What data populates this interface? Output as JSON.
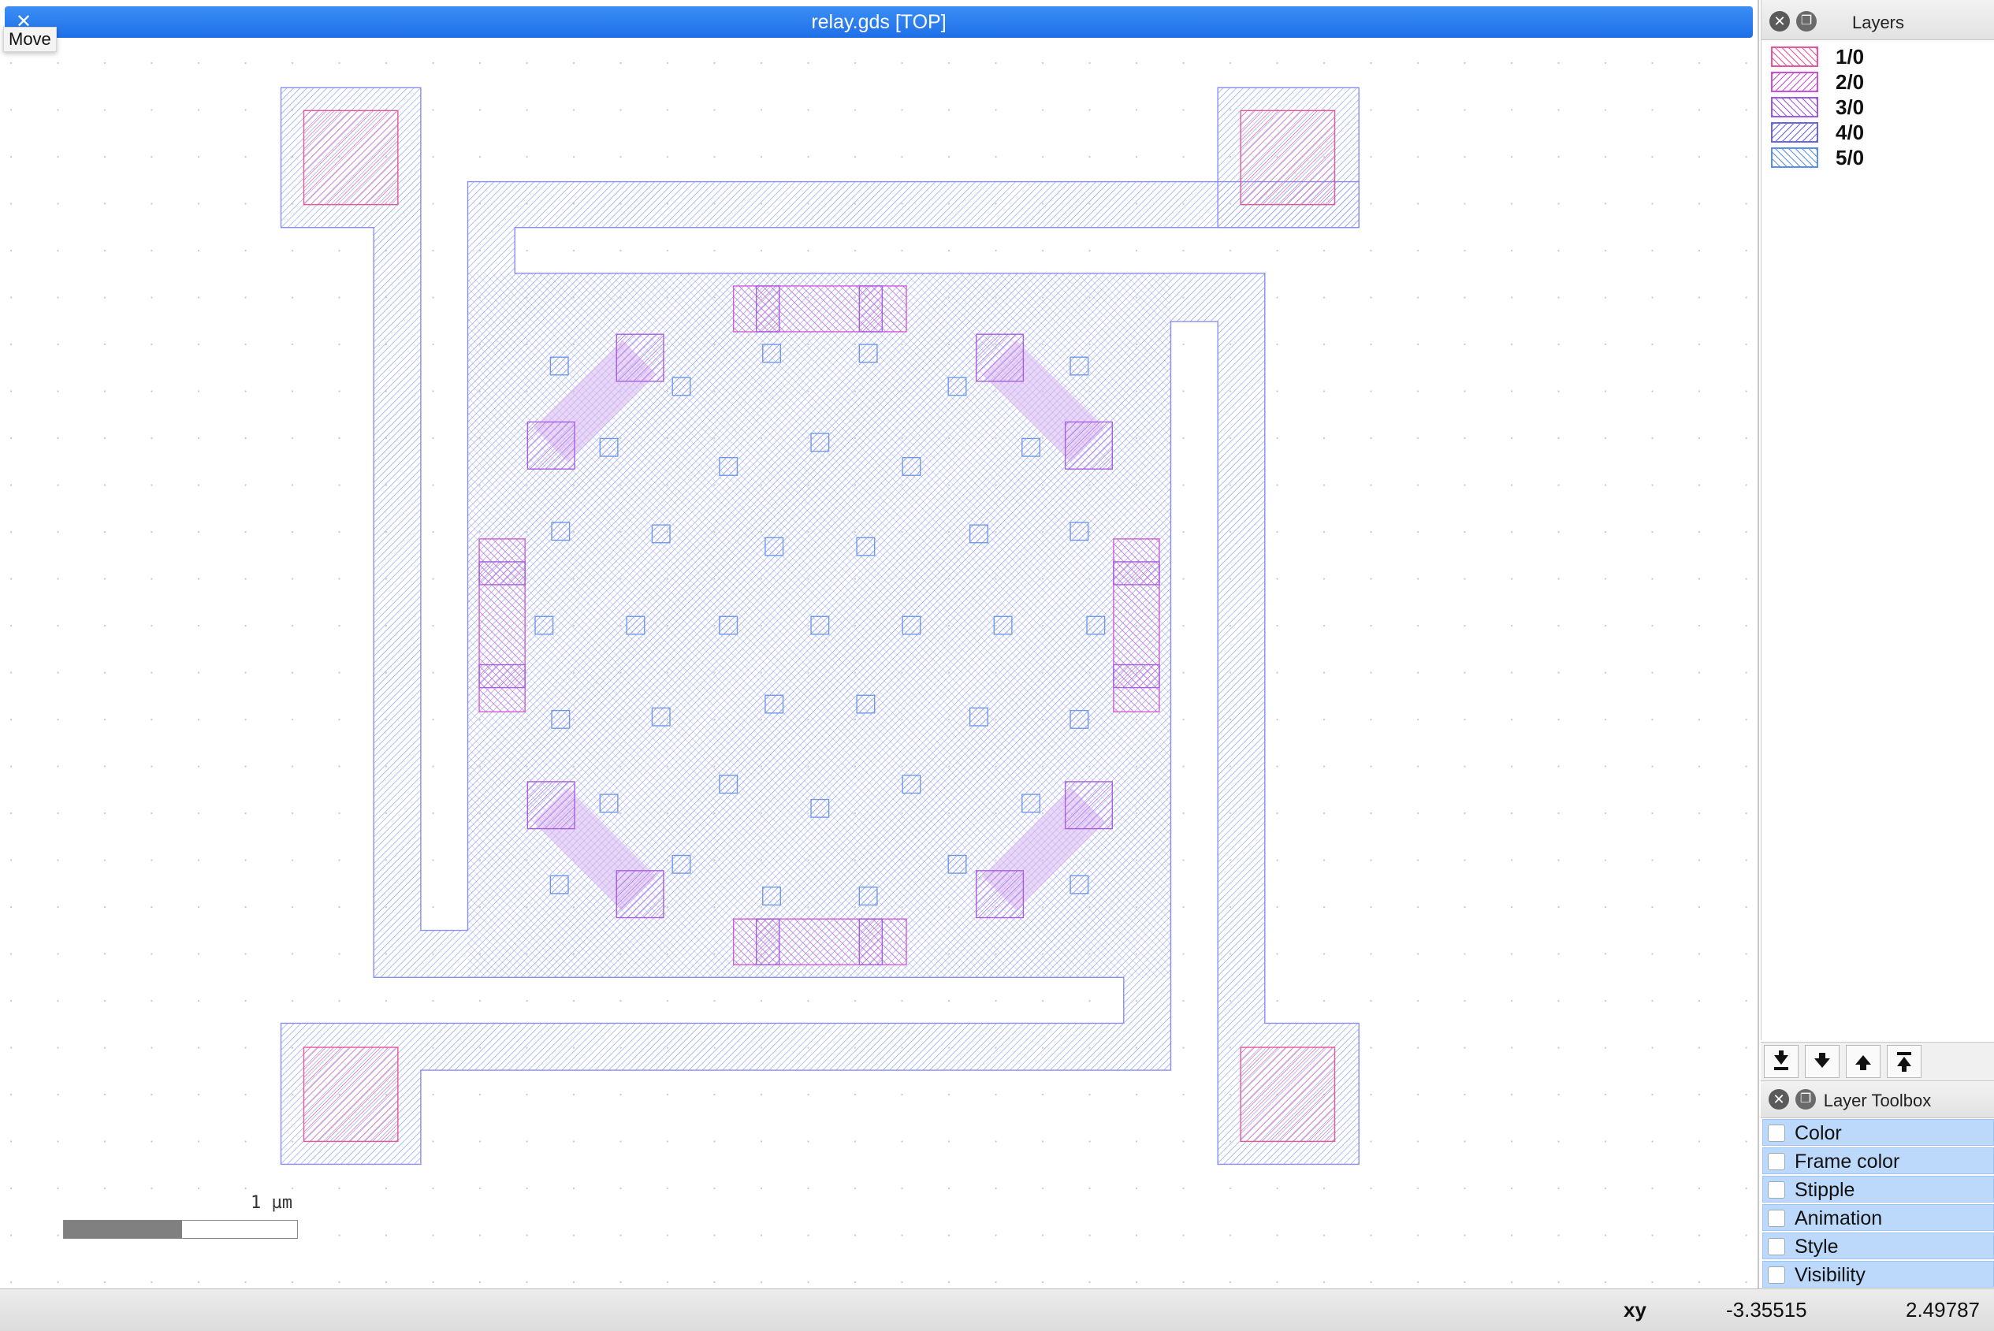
{
  "window": {
    "title": "relay.gds [TOP]",
    "tooltip": "Move"
  },
  "scalebar": {
    "label": "1 µm"
  },
  "layers_panel": {
    "title": "Layers",
    "layers": [
      {
        "name": "1/0",
        "color": "#e8559a"
      },
      {
        "name": "2/0",
        "color": "#cc50d8"
      },
      {
        "name": "3/0",
        "color": "#9e58e6"
      },
      {
        "name": "4/0",
        "color": "#6a64e6"
      },
      {
        "name": "5/0",
        "color": "#5c8fea"
      }
    ],
    "buttons": [
      "move-to-bottom-icon",
      "move-down-icon",
      "move-up-icon",
      "move-to-top-icon"
    ]
  },
  "toolbox": {
    "title": "Layer Toolbox",
    "items": [
      "Color",
      "Frame color",
      "Stipple",
      "Animation",
      "Style",
      "Visibility"
    ]
  },
  "status": {
    "mode": "xy",
    "x": "-3.35515",
    "y": "2.49787"
  },
  "colors": {
    "title_bar": "#2f80f0",
    "selection": "#bcd9fb",
    "shape_outline": "#8b8cf0"
  }
}
